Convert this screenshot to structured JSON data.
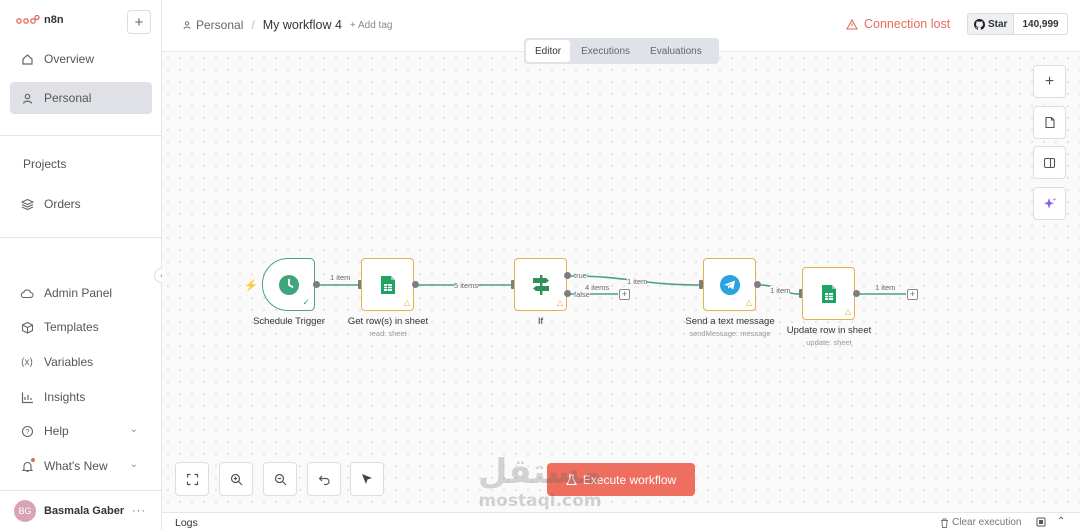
{
  "app": {
    "logo_text": "n8n"
  },
  "sidebar": {
    "top_items": [
      {
        "label": "Overview",
        "icon": "home-icon"
      },
      {
        "label": "Personal",
        "icon": "user-icon",
        "active": true
      }
    ],
    "projects_title": "Projects",
    "projects": [
      {
        "label": "Orders",
        "icon": "layers-icon"
      }
    ],
    "bottom_items": [
      {
        "label": "Admin Panel",
        "icon": "cloud-icon"
      },
      {
        "label": "Templates",
        "icon": "box-icon"
      },
      {
        "label": "Variables",
        "icon": "variables-icon"
      },
      {
        "label": "Insights",
        "icon": "chart-icon"
      },
      {
        "label": "Help",
        "icon": "help-icon"
      },
      {
        "label": "What's New",
        "icon": "bell-icon"
      }
    ],
    "user": {
      "initials": "BG",
      "name": "Basmala Gaber",
      "more": "···"
    }
  },
  "header": {
    "project": "Personal",
    "separator": "/",
    "workflow_name": "My workflow 4",
    "add_tag": "+ Add tag",
    "connection_status": "Connection lost",
    "github": {
      "star_label": "Star",
      "count": "140,999"
    }
  },
  "tabs": [
    {
      "label": "Editor",
      "active": true
    },
    {
      "label": "Executions"
    },
    {
      "label": "Evaluations"
    }
  ],
  "nodes": [
    {
      "label": "Schedule Trigger",
      "sub": "",
      "icon": "clock-icon"
    },
    {
      "label": "Get row(s) in sheet",
      "sub": "read: sheet",
      "icon": "google-sheets-icon"
    },
    {
      "label": "If",
      "sub": "",
      "icon": "signpost-icon"
    },
    {
      "label": "Send a text message",
      "sub": "sendMessage: message",
      "icon": "telegram-icon"
    },
    {
      "label": "Update row in sheet",
      "sub": "update: sheet",
      "icon": "google-sheets-icon"
    }
  ],
  "edges": {
    "trigger_to_get": "1 item",
    "get_to_if": "5 items",
    "if_true_to_telegram": "1 item",
    "if_false_count": "4 items",
    "true_label": "true",
    "false_label": "false",
    "telegram_to_update": "1 item",
    "update_out": "1 item"
  },
  "toolbar": {
    "execute_label": "Execute workflow"
  },
  "logs": {
    "label": "Logs",
    "clear_label": "Clear execution"
  },
  "watermark": {
    "arabic": "مستقل",
    "latin": "mostaql.com"
  },
  "colors": {
    "accent": "#ee6f60",
    "edge_success": "#4aa37a",
    "warning": "#e5b24a",
    "active_nav": "#dfe1e6"
  }
}
